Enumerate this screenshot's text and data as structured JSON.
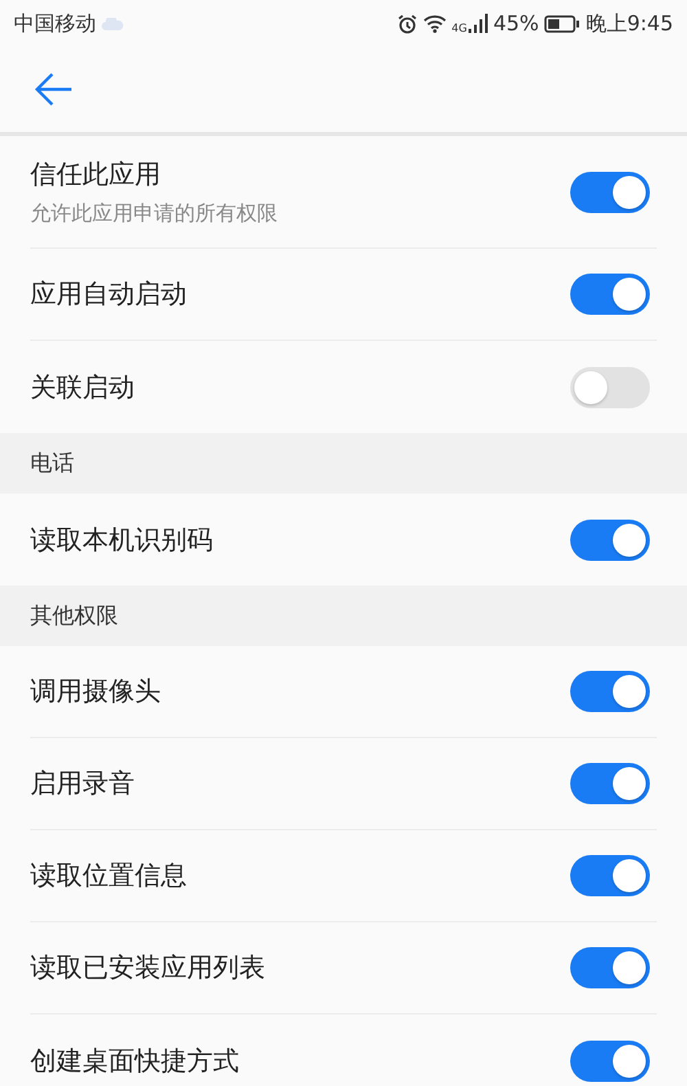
{
  "status_bar": {
    "carrier": "中国移动",
    "battery": "45%",
    "network": "4G",
    "time": "晚上9:45"
  },
  "rows": [
    {
      "kind": "toggle",
      "label": "信任此应用",
      "sublabel": "允许此应用申请的所有权限",
      "on": true
    },
    {
      "kind": "toggle",
      "label": "应用自动启动",
      "on": true
    },
    {
      "kind": "toggle",
      "label": "关联启动",
      "on": false
    },
    {
      "kind": "header",
      "label": "电话"
    },
    {
      "kind": "toggle",
      "label": "读取本机识别码",
      "on": true
    },
    {
      "kind": "header",
      "label": "其他权限"
    },
    {
      "kind": "toggle",
      "label": "调用摄像头",
      "on": true
    },
    {
      "kind": "toggle",
      "label": "启用录音",
      "on": true
    },
    {
      "kind": "toggle",
      "label": "读取位置信息",
      "on": true
    },
    {
      "kind": "toggle",
      "label": "读取已安装应用列表",
      "on": true
    },
    {
      "kind": "toggle",
      "label": "创建桌面快捷方式",
      "on": true
    }
  ]
}
